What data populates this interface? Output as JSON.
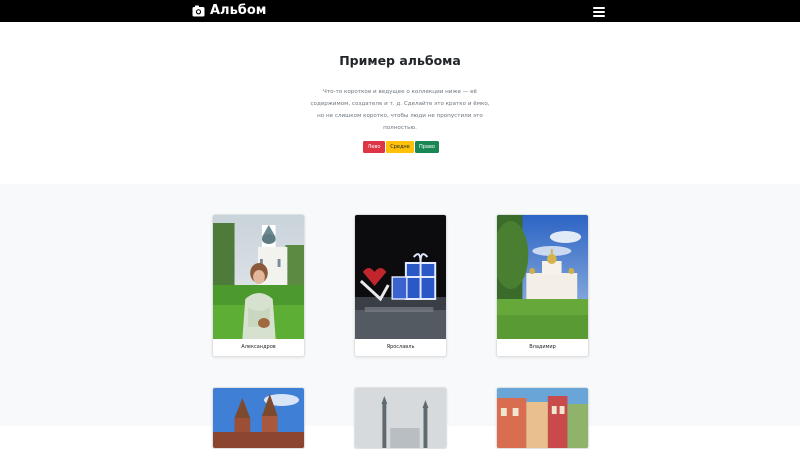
{
  "navbar": {
    "brand_icon": "camera-icon",
    "brand": "Альбом",
    "menu_icon": "hamburger-menu-icon"
  },
  "hero": {
    "title": "Пример альбома",
    "lead": "Что-то короткое и ведущее о коллекции ниже — её содержимом, создателе и т. д. Сделайте это кратко и ёмко, но не слишком коротко, чтобы люди не пропустили это полностью.",
    "buttons": {
      "red": "Лево",
      "yellow": "Средне",
      "green": "Право"
    }
  },
  "album": {
    "cards": [
      {
        "caption": "Александров",
        "photo": "photo-church-woman"
      },
      {
        "caption": "Ярославль",
        "photo": "photo-night-installation"
      },
      {
        "caption": "Владимир",
        "photo": "photo-cathedral"
      },
      {
        "caption": "",
        "photo": "photo-fortress-towers"
      },
      {
        "caption": "",
        "photo": "photo-mosque-minarets"
      },
      {
        "caption": "",
        "photo": "photo-colorful-street"
      }
    ]
  },
  "colors": {
    "navbar_bg": "#000000",
    "album_bg": "#f8f9fa",
    "btn_red": "#dc3545",
    "btn_yellow": "#ffc107",
    "btn_green": "#198754"
  }
}
